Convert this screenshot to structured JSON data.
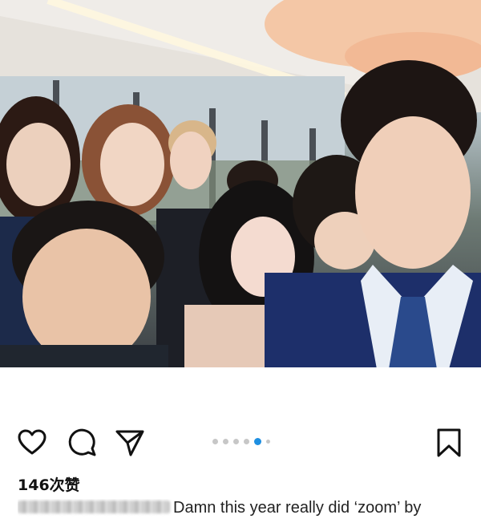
{
  "post": {
    "photo_alt": "group selfie",
    "likes_text": "146次赞",
    "caption_text": "Damn this year really did ‘zoom’ by",
    "carousel": {
      "count": 6,
      "active_index": 4
    }
  },
  "actions": {
    "like_icon": "heart-icon",
    "comment_icon": "comment-icon",
    "share_icon": "send-icon",
    "save_icon": "bookmark-icon"
  },
  "colors": {
    "accent": "#1e8fe1",
    "dot_inactive": "#c7c7c7",
    "text": "#111111"
  }
}
